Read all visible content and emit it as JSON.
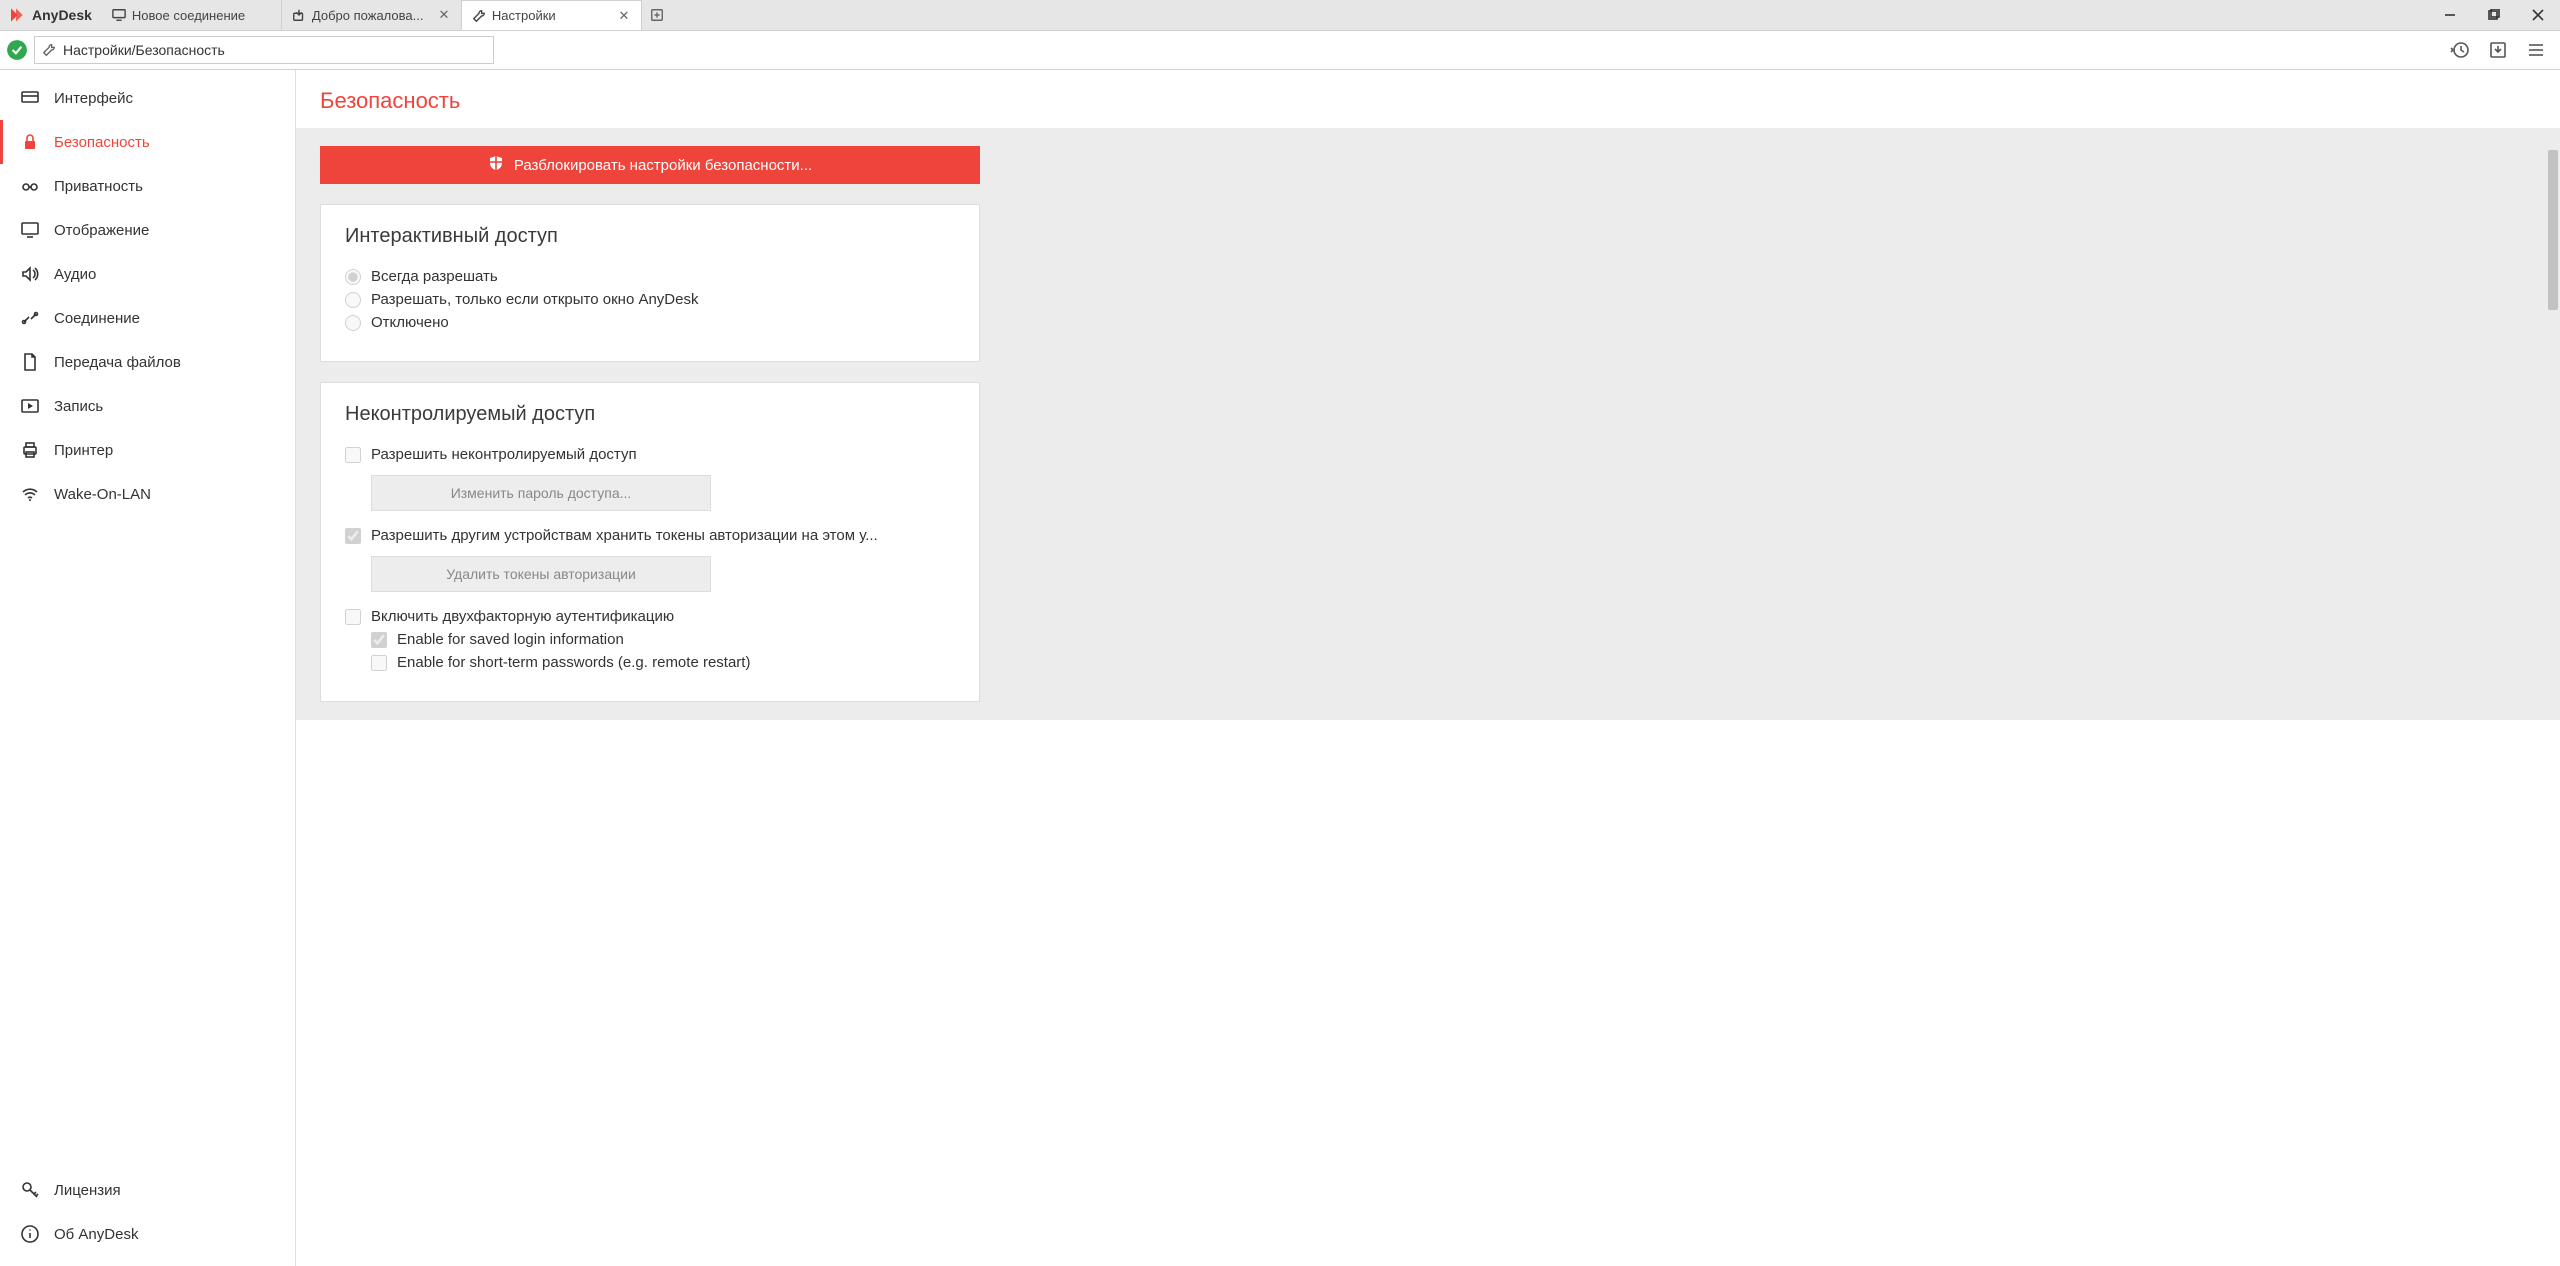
{
  "app_name": "AnyDesk",
  "tabs": [
    {
      "label": "Новое соединение",
      "closable": false
    },
    {
      "label": "Добро пожалова...",
      "closable": true
    },
    {
      "label": "Настройки",
      "closable": true
    }
  ],
  "active_tab_index": 2,
  "address": "Настройки/Безопасность",
  "sidebar": {
    "items": [
      {
        "label": "Интерфейс",
        "icon": "interface"
      },
      {
        "label": "Безопасность",
        "icon": "lock"
      },
      {
        "label": "Приватность",
        "icon": "privacy"
      },
      {
        "label": "Отображение",
        "icon": "display"
      },
      {
        "label": "Аудио",
        "icon": "audio"
      },
      {
        "label": "Соединение",
        "icon": "connection"
      },
      {
        "label": "Передача файлов",
        "icon": "filetransfer"
      },
      {
        "label": "Запись",
        "icon": "record"
      },
      {
        "label": "Принтер",
        "icon": "printer"
      },
      {
        "label": "Wake-On-LAN",
        "icon": "wol"
      }
    ],
    "active_index": 1,
    "bottom": [
      {
        "label": "Лицензия",
        "icon": "license"
      },
      {
        "label": "Об AnyDesk",
        "icon": "about"
      }
    ]
  },
  "page": {
    "title": "Безопасность",
    "unlock_button": "Разблокировать настройки безопасности...",
    "section_interactive": {
      "title": "Интерактивный доступ",
      "options": [
        "Всегда разрешать",
        "Разрешать, только если открыто окно AnyDesk",
        "Отключено"
      ],
      "selected": 0
    },
    "section_unattended": {
      "title": "Неконтролируемый доступ",
      "check_allow": "Разрешить неконтролируемый доступ",
      "btn_change_pw": "Изменить пароль доступа...",
      "check_tokens": "Разрешить другим устройствам хранить токены авторизации на этом у...",
      "btn_delete_tokens": "Удалить токены авторизации",
      "check_2fa": "Включить двухфакторную аутентификацию",
      "check_2fa_saved": "Enable for saved login information",
      "check_2fa_short": "Enable for short-term passwords (e.g. remote restart)"
    }
  }
}
